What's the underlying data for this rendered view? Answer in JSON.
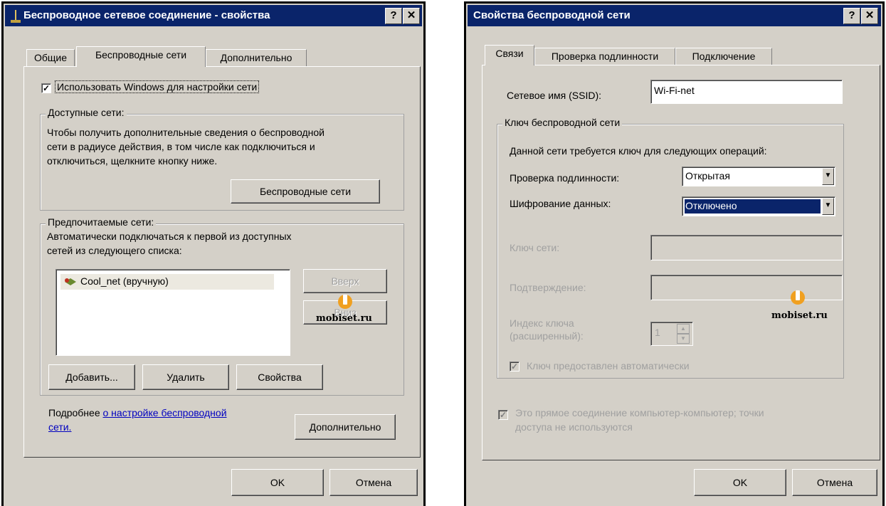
{
  "left": {
    "title": "Беспроводное сетевое соединение - свойства",
    "title_buttons": [
      "?",
      "✕"
    ],
    "tabs": [
      "Общие",
      "Беспроводные сети",
      "Дополнительно"
    ],
    "use_windows_checkbox": "Использовать Windows для настройки сети",
    "available": {
      "legend": "Доступные сети:",
      "text": [
        "Чтобы получить дополнительные сведения о беспроводной",
        "сети в радиусе действия, в том числе как подключиться и",
        "отключиться, щелкните кнопку ниже."
      ],
      "button": "Беспроводные сети"
    },
    "preferred": {
      "legend": "Предпочитаемые сети:",
      "text": [
        "Автоматически подключаться к первой из доступных",
        "сетей из следующего списка:"
      ],
      "list": [
        "Cool_net (вручную)"
      ],
      "up_button": "Вверх",
      "down_button": "Вниз",
      "add_button": "Добавить...",
      "remove_button": "Удалить",
      "properties_button": "Свойства"
    },
    "more_text": "Подробнее",
    "more_link_1": "о настройке  беспроводной",
    "more_link_2": "сети.",
    "advanced_button": "Дополнительно",
    "ok_button": "OK",
    "cancel_button": "Отмена",
    "watermark": "mobiset.ru"
  },
  "right": {
    "title": "Свойства беспроводной сети",
    "title_buttons": [
      "?",
      "✕"
    ],
    "tabs": [
      "Связи",
      "Проверка подлинности",
      "Подключение"
    ],
    "ssid_label": "Сетевое имя (SSID):",
    "ssid_value": "Wi-Fi-net",
    "key_group": {
      "legend": "Ключ беспроводной сети",
      "text": "Данной сети требуется ключ для следующих операций:",
      "auth_label": "Проверка подлинности:",
      "auth_value": "Открытая",
      "enc_label": "Шифрование данных:",
      "enc_value": "Отключено",
      "netkey_label": "Ключ сети:",
      "confirm_label": "Подтверждение:",
      "index_label_1": "Индекс ключа",
      "index_label_2": "(расширенный):",
      "index_value": "1",
      "auto_key_checkbox": "Ключ предоставлен автоматически"
    },
    "adhoc_text_1": "Это прямое соединение компьютер-компьютер; точки",
    "adhoc_text_2": "доступа не используются",
    "ok_button": "OK",
    "cancel_button": "Отмена",
    "watermark": "mobiset.ru"
  },
  "colors": {
    "titlebar": "#0a246a",
    "dialog": "#d4d0c8",
    "link": "#0000c0",
    "selection": "#0a246a"
  }
}
